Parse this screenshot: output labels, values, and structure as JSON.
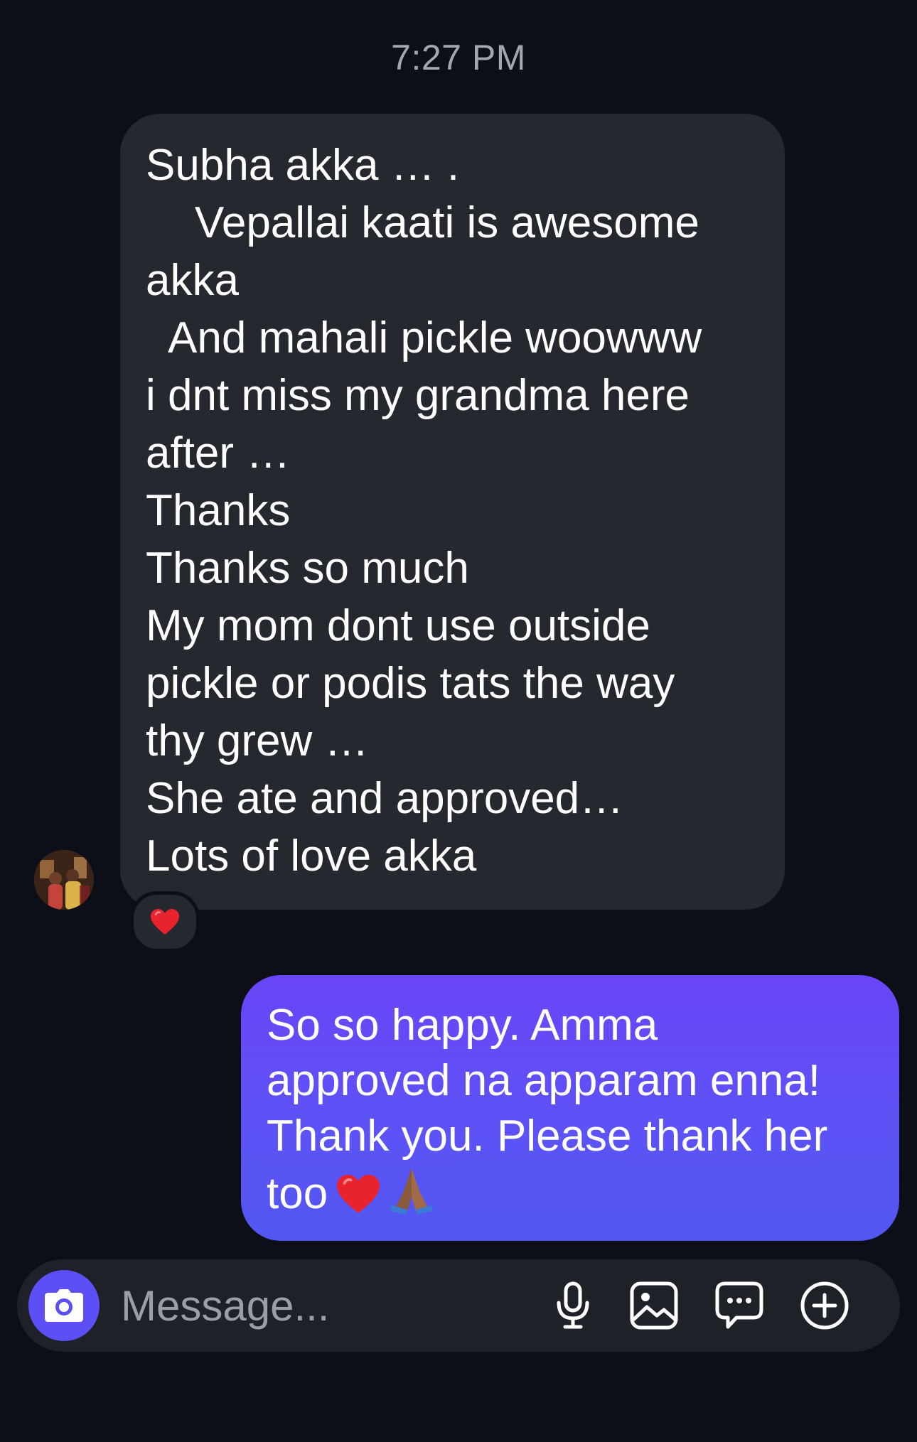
{
  "thread": {
    "timestamp": "7:27 PM"
  },
  "incoming_message": {
    "lines": [
      "Subha akka … .",
      "    Vepallai kaati is awesome",
      "akka",
      "  And mahali pickle woowww",
      "i dnt miss my grandma here",
      "after …",
      "Thanks",
      "Thanks so much",
      "My mom dont use outside",
      "pickle or podis tats the way",
      "thy grew …",
      "She ate and approved…",
      "Lots of love akka"
    ],
    "reaction": "heart"
  },
  "outgoing_message": {
    "lines": [
      "So so happy. Amma",
      "approved na apparam enna!",
      "Thank you. Please thank her",
      "too"
    ],
    "trailing_emoji": [
      "red-heart",
      "folded-hands"
    ]
  },
  "composer": {
    "placeholder": "Message...",
    "icons": [
      "camera-icon",
      "microphone-icon",
      "gallery-icon",
      "sticker-icon",
      "plus-icon"
    ]
  },
  "colors": {
    "background": "#0c0f17",
    "incoming_bubble": "#25282e",
    "outgoing_bubble": "#5d52f6",
    "accent": "#5b4ff5",
    "timestamp_text": "#a2a6b0"
  }
}
